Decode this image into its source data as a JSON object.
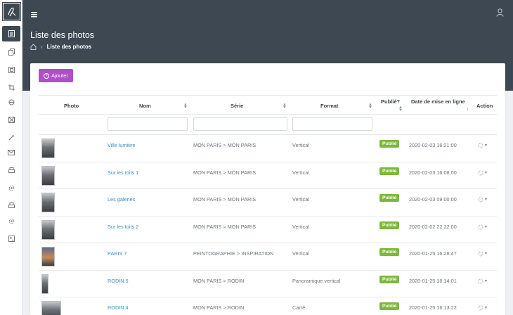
{
  "header": {
    "page_title": "Liste des photos",
    "breadcrumb_current": "Liste des photos"
  },
  "toolbar": {
    "add_label": "Ajouter"
  },
  "table": {
    "columns": [
      "Photo",
      "Nom",
      "Série",
      "Format",
      "Publié?",
      "Date de mise en ligne",
      "Action"
    ],
    "rows": [
      {
        "name": "Ville lumière",
        "serie": "MON PARIS > MON PARIS",
        "format": "Vertical",
        "status": "Publié",
        "date": "2020-02-03 16:21:00"
      },
      {
        "name": "Sur les toits 1",
        "serie": "MON PARIS > MON PARIS",
        "format": "Vertical",
        "status": "Publié",
        "date": "2020-02-03 16:08:00"
      },
      {
        "name": "Les galeries",
        "serie": "MON PARIS > MON PARIS",
        "format": "Vertical",
        "status": "Publié",
        "date": "2020-02-03 09:00:00"
      },
      {
        "name": "Sur les toits 2",
        "serie": "MON PARIS > MON PARIS",
        "format": "Vertical",
        "status": "Publié",
        "date": "2020-02-02 22:22:00"
      },
      {
        "name": "PARIS 7",
        "serie": "PEINTOGRAPHIE > INSPIRATION",
        "format": "Vertical",
        "status": "Publié",
        "date": "2020-01-25 16:28:47"
      },
      {
        "name": "RODIN 5",
        "serie": "MON PARIS > RODIN",
        "format": "Panoramique vertical",
        "status": "Publié",
        "date": "2020-01-25 16:14:01"
      },
      {
        "name": "RODIN 4",
        "serie": "MON PARIS > RODIN",
        "format": "Carré",
        "status": "Publié",
        "date": "2020-01-25 16:13:22"
      }
    ]
  },
  "colors": {
    "header_bg": "#3d4852",
    "accent": "#b14ec9",
    "published": "#7cb83b",
    "link": "#3a8fc7"
  },
  "sidebar_icons": [
    "logo-icon",
    "photos-icon",
    "copy-icon",
    "image-frame-icon",
    "crop-icon",
    "stamp-icon",
    "cancel-image-icon",
    "brush-icon",
    "mail-icon",
    "printer-icon",
    "gear-icon",
    "printer-icon",
    "gear-icon",
    "contact-card-icon"
  ]
}
